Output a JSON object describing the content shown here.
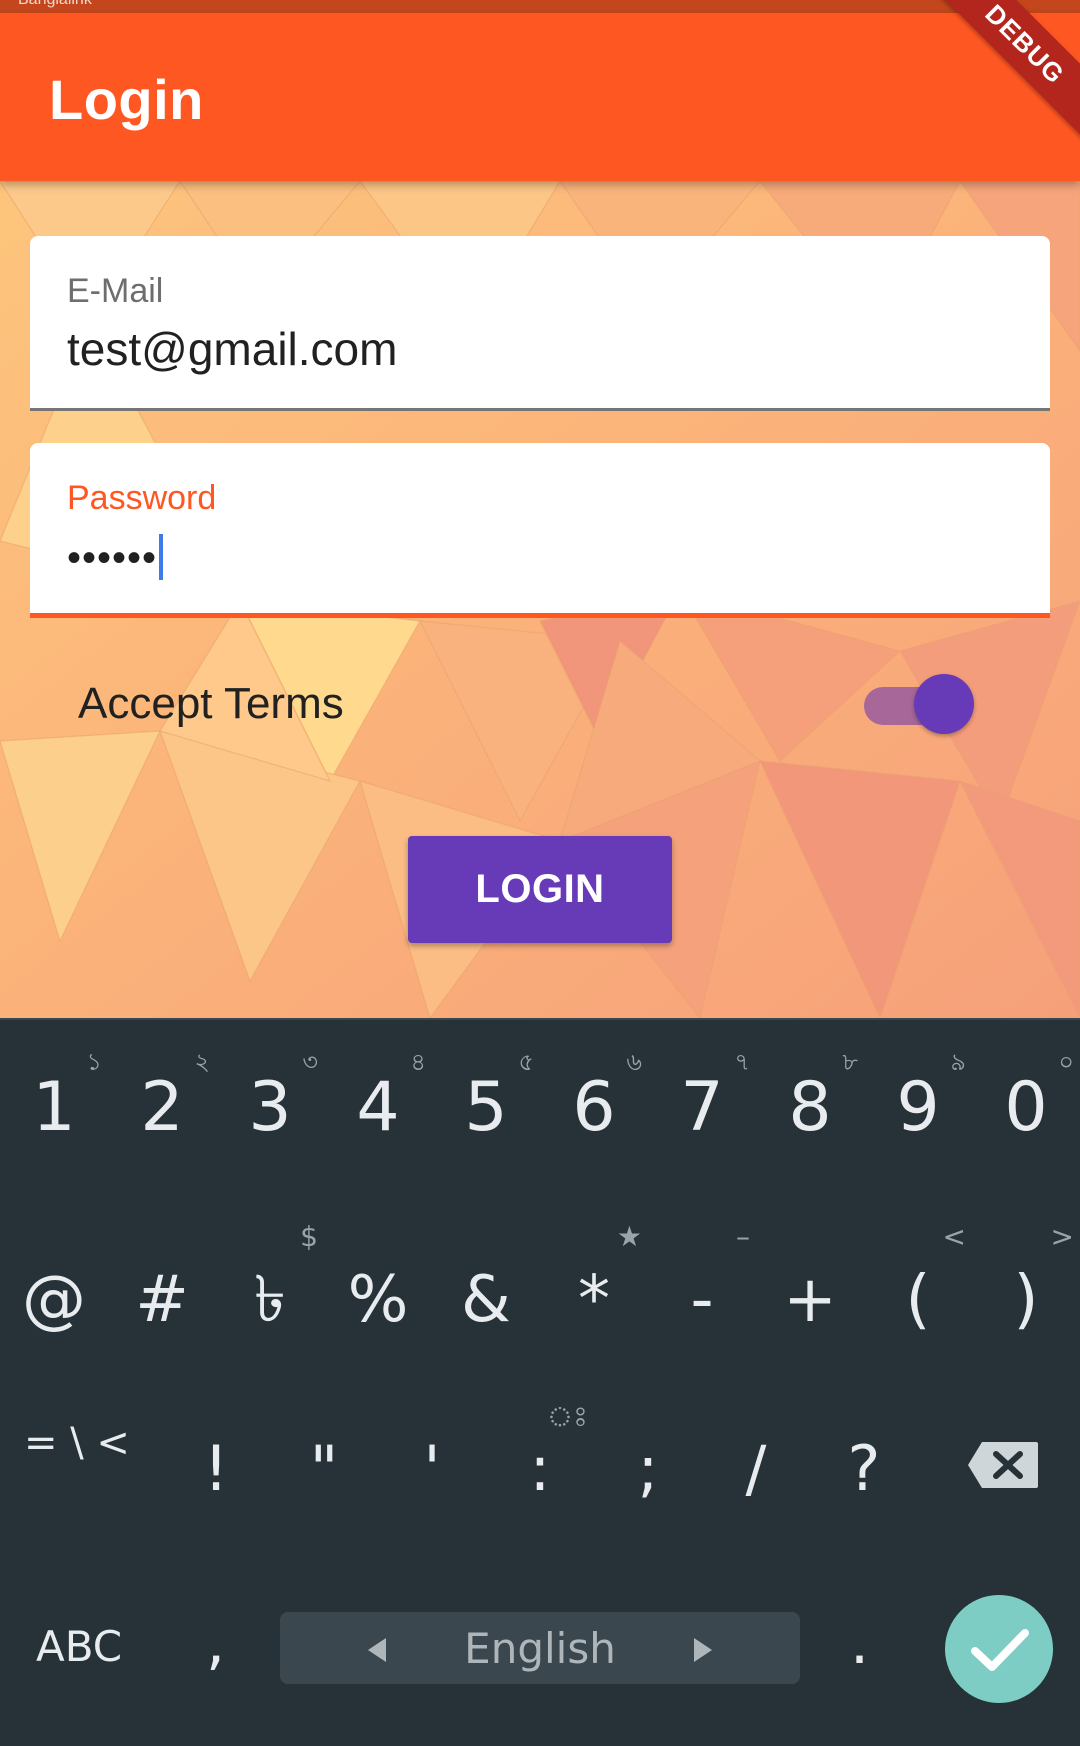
{
  "status_bar": {
    "carrier": "Banglalink"
  },
  "appbar": {
    "title": "Login",
    "debug_banner": "DEBUG"
  },
  "form": {
    "email": {
      "label": "E-Mail",
      "value": "test@gmail.com"
    },
    "password": {
      "label": "Password",
      "masked_value": "••••••"
    },
    "terms": {
      "label": "Accept Terms",
      "switch_on": true
    },
    "login_button": "LOGIN"
  },
  "colors": {
    "appbar": "#ff5722",
    "accent": "#673ab7",
    "focus": "#ff5722",
    "keyboard_bg": "#263238",
    "enter_key": "#7ecdc4"
  },
  "keyboard": {
    "row1": [
      {
        "main": "1",
        "hint": "১"
      },
      {
        "main": "2",
        "hint": "২"
      },
      {
        "main": "3",
        "hint": "৩"
      },
      {
        "main": "4",
        "hint": "৪"
      },
      {
        "main": "5",
        "hint": "৫"
      },
      {
        "main": "6",
        "hint": "৬"
      },
      {
        "main": "7",
        "hint": "৭"
      },
      {
        "main": "8",
        "hint": "৮"
      },
      {
        "main": "9",
        "hint": "৯"
      },
      {
        "main": "0",
        "hint": "০"
      }
    ],
    "row2": [
      {
        "main": "@",
        "hint": ""
      },
      {
        "main": "#",
        "hint": ""
      },
      {
        "main": "৳",
        "hint": "$"
      },
      {
        "main": "%",
        "hint": ""
      },
      {
        "main": "&",
        "hint": ""
      },
      {
        "main": "*",
        "hint": "★"
      },
      {
        "main": "-",
        "hint": "–"
      },
      {
        "main": "+",
        "hint": ""
      },
      {
        "main": "(",
        "hint": "<"
      },
      {
        "main": ")",
        "hint": ">"
      }
    ],
    "row3": [
      {
        "main": "!",
        "hint": ""
      },
      {
        "main": "\"",
        "hint": ""
      },
      {
        "main": "'",
        "hint": ""
      },
      {
        "main": ":",
        "hint": "ঃ"
      },
      {
        "main": ";",
        "hint": ""
      },
      {
        "main": "/",
        "hint": ""
      },
      {
        "main": "?",
        "hint": ""
      }
    ],
    "symbols_key": "= \\ <",
    "abc_key": "ABC",
    "comma_key": ",",
    "space_language": "English",
    "period_key": ".",
    "backspace_icon": "backspace-icon",
    "enter_icon": "check-icon"
  }
}
